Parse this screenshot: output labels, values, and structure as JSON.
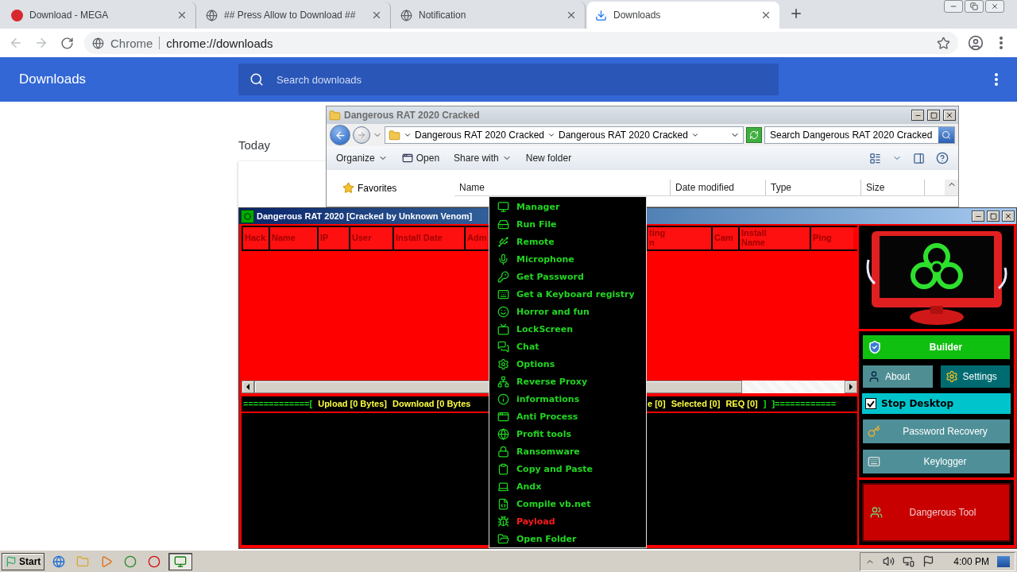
{
  "browser": {
    "tabs": [
      {
        "title": "Download - MEGA",
        "selected": false
      },
      {
        "title": "## Press Allow to Download ##",
        "selected": false
      },
      {
        "title": "Notification",
        "selected": false
      },
      {
        "title": "Downloads",
        "selected": true
      }
    ],
    "address": {
      "origin": "Chrome",
      "url": "chrome://downloads"
    }
  },
  "downloads_page": {
    "title": "Downloads",
    "search": {
      "placeholder": "Search downloads"
    },
    "section": "Today"
  },
  "explorer": {
    "title": "Dangerous RAT 2020 Cracked",
    "breadcrumbs": [
      "Dangerous RAT 2020 Cracked",
      "Dangerous RAT 2020 Cracked"
    ],
    "search": {
      "placeholder": "Search Dangerous RAT 2020 Cracked"
    },
    "toolbar": [
      {
        "label": "Organize",
        "kind": "menu"
      },
      {
        "label": "Open",
        "kind": "icon"
      },
      {
        "label": "Share with",
        "kind": "menu"
      },
      {
        "label": "New folder",
        "kind": "plain"
      }
    ],
    "nav": [
      "Favorites"
    ],
    "columns": [
      "Name",
      "Date modified",
      "Type",
      "Size"
    ]
  },
  "rat": {
    "title": "Dangerous RAT 2020 [Cracked by Unknown Venom]",
    "columns_left": [
      "Hack",
      "Name",
      "IP",
      "User",
      "Install Date",
      "Adm"
    ],
    "columns_right": [
      "ting\nn",
      "Cam",
      "Install\nName",
      "Ping"
    ],
    "status_left": [
      {
        "kind": "frame",
        "text": "=============["
      },
      {
        "kind": "stat",
        "text": "Upload [0 Bytes]"
      },
      {
        "kind": "stat",
        "text": "Download [0 Bytes"
      }
    ],
    "status_right": [
      {
        "kind": "stat",
        "text": "e [0]"
      },
      {
        "kind": "stat",
        "text": "Selected [0]"
      },
      {
        "kind": "stat",
        "text": "REQ [0]"
      },
      {
        "kind": "frame",
        "text": "]"
      },
      {
        "kind": "frame",
        "text": "]============"
      }
    ],
    "panel": {
      "builder": "Builder",
      "about": "About",
      "settings": "Settings",
      "stop_desktop": {
        "label": "Stop Desktop",
        "checked": true
      },
      "password_recovery": "Password Recovery",
      "keylogger": "Keylogger",
      "tool": "Dangerous Tool"
    }
  },
  "menu": [
    {
      "label": "Manager",
      "kind": "normal"
    },
    {
      "label": "Run File",
      "kind": "normal"
    },
    {
      "label": "Remote",
      "kind": "normal"
    },
    {
      "label": "Microphone",
      "kind": "normal"
    },
    {
      "label": "Get Password",
      "kind": "normal"
    },
    {
      "label": "Get a Keyboard registry",
      "kind": "normal"
    },
    {
      "label": "Horror and fun",
      "kind": "normal"
    },
    {
      "label": "LockScreen",
      "kind": "normal"
    },
    {
      "label": "Chat",
      "kind": "normal"
    },
    {
      "label": "Options",
      "kind": "normal"
    },
    {
      "label": "Reverse Proxy",
      "kind": "normal"
    },
    {
      "label": "informations",
      "kind": "normal"
    },
    {
      "label": "Anti Process",
      "kind": "normal"
    },
    {
      "label": "Profit tools",
      "kind": "normal"
    },
    {
      "label": "Ransomware",
      "kind": "normal"
    },
    {
      "label": "Copy and Paste",
      "kind": "normal"
    },
    {
      "label": "Andx",
      "kind": "normal"
    },
    {
      "label": "Compile vb.net",
      "kind": "normal"
    },
    {
      "label": "Payload",
      "kind": "danger"
    },
    {
      "label": "Open Folder",
      "kind": "normal"
    }
  ],
  "taskbar": {
    "start": "Start",
    "apps": [
      {
        "selected": false
      },
      {
        "selected": false
      },
      {
        "selected": false
      },
      {
        "selected": false
      },
      {
        "selected": false
      },
      {
        "selected": true
      }
    ],
    "clock": "4:00 PM"
  }
}
